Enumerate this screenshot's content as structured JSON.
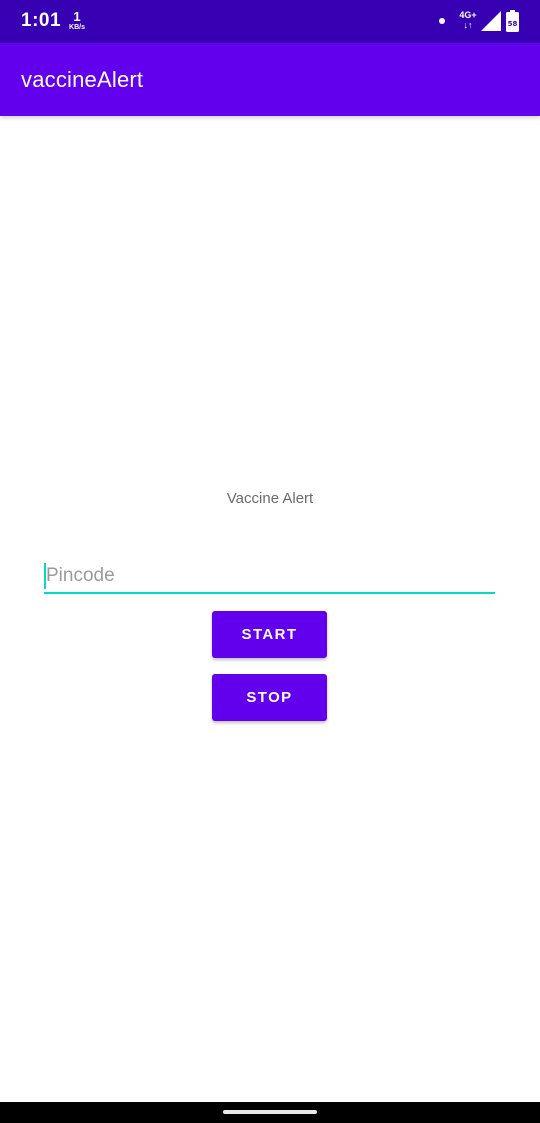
{
  "status_bar": {
    "time": "1:01",
    "net_speed_value": "1",
    "net_speed_unit": "KB/s",
    "network_type": "4G+",
    "network_arrows": "↓↑",
    "battery_level": "58",
    "icons": [
      "notification-dot-icon",
      "signal-icon",
      "battery-icon"
    ]
  },
  "app_bar": {
    "title": "vaccineAlert"
  },
  "main": {
    "heading": "Vaccine Alert",
    "pincode": {
      "value": "",
      "placeholder": "Pincode"
    },
    "start_button_label": "START",
    "stop_button_label": "STOP"
  },
  "colors": {
    "status_bar": "#3700b3",
    "app_bar": "#6200ee",
    "accent": "#03dac5",
    "button": "#6200ee"
  }
}
